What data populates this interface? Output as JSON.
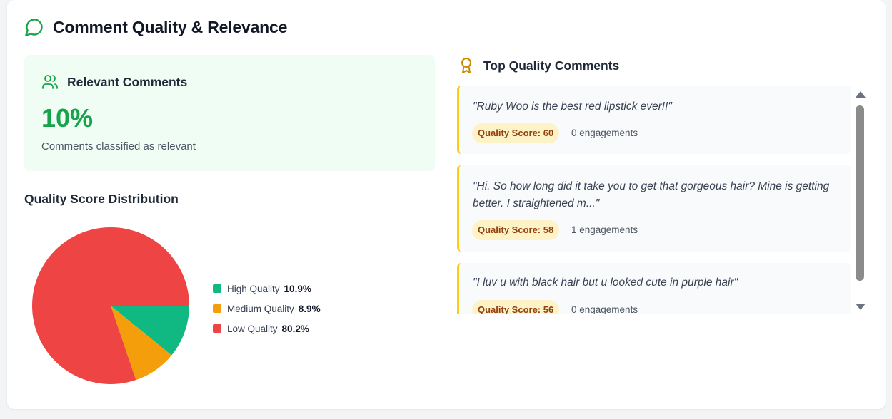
{
  "header": {
    "title": "Comment Quality & Relevance",
    "icon": "message-circle-icon"
  },
  "relevant": {
    "title": "Relevant Comments",
    "value": "10%",
    "subtitle": "Comments classified as relevant",
    "icon": "users-icon",
    "accent": "#16a34a"
  },
  "distribution": {
    "title": "Quality Score Distribution"
  },
  "chart_data": {
    "type": "pie",
    "title": "",
    "categories": [
      "High Quality",
      "Medium Quality",
      "Low Quality"
    ],
    "values": [
      10.9,
      8.9,
      80.2
    ],
    "value_labels": [
      "10.9%",
      "8.9%",
      "80.2%"
    ],
    "colors": [
      "#10b981",
      "#f59e0b",
      "#ef4444"
    ],
    "legend_position": "right"
  },
  "top_comments": {
    "title": "Top Quality Comments",
    "icon": "award-icon",
    "items": [
      {
        "text": "\"Ruby Woo is the best red lipstick ever!!\"",
        "score_label": "Quality Score: 60",
        "engagements": "0 engagements"
      },
      {
        "text": "\"Hi. So how long did it take you to get that gorgeous hair? Mine is getting better. I straightened m...\"",
        "score_label": "Quality Score: 58",
        "engagements": "1 engagements"
      },
      {
        "text": "\"I luv u with black hair but u looked cute in purple hair\"",
        "score_label": "Quality Score: 56",
        "engagements": "0 engagements"
      }
    ]
  }
}
